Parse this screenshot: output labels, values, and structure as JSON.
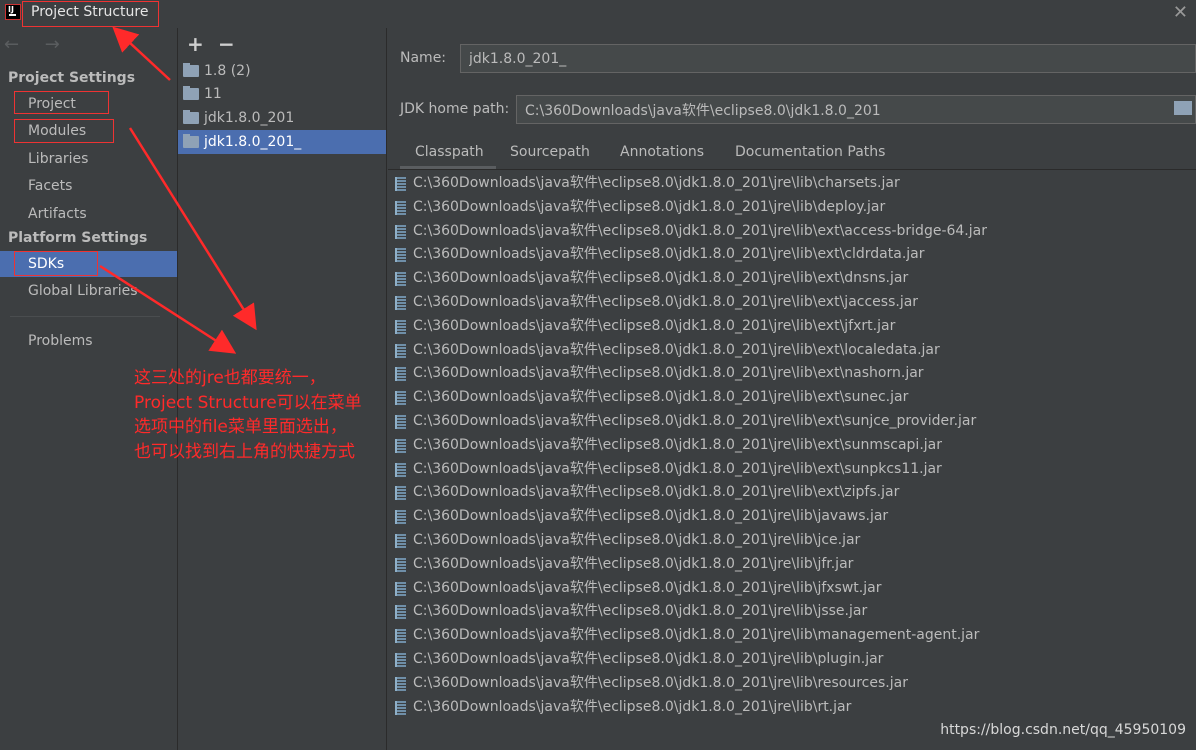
{
  "window": {
    "title": "Project Structure",
    "close_glyph": "✕"
  },
  "nav": {
    "back_forward": "← →",
    "project_settings_title": "Project Settings",
    "project_items": [
      "Project",
      "Modules",
      "Libraries",
      "Facets",
      "Artifacts"
    ],
    "platform_settings_title": "Platform Settings",
    "platform_items": [
      "SDKs",
      "Global Libraries"
    ],
    "problems": "Problems",
    "selected": "SDKs"
  },
  "sdk_panel": {
    "add_label": "+",
    "remove_label": "−",
    "items": [
      "1.8 (2)",
      "11",
      "jdk1.8.0_201",
      "jdk1.8.0_201_"
    ],
    "selected_index": 3
  },
  "detail": {
    "name_label": "Name:",
    "name_value": "jdk1.8.0_201_",
    "home_label": "JDK home path:",
    "home_value": "C:\\360Downloads\\java软件\\eclipse8.0\\jdk1.8.0_201",
    "tabs": [
      "Classpath",
      "Sourcepath",
      "Annotations",
      "Documentation Paths"
    ],
    "active_tab": "Classpath",
    "classpath": [
      "C:\\360Downloads\\java软件\\eclipse8.0\\jdk1.8.0_201\\jre\\lib\\charsets.jar",
      "C:\\360Downloads\\java软件\\eclipse8.0\\jdk1.8.0_201\\jre\\lib\\deploy.jar",
      "C:\\360Downloads\\java软件\\eclipse8.0\\jdk1.8.0_201\\jre\\lib\\ext\\access-bridge-64.jar",
      "C:\\360Downloads\\java软件\\eclipse8.0\\jdk1.8.0_201\\jre\\lib\\ext\\cldrdata.jar",
      "C:\\360Downloads\\java软件\\eclipse8.0\\jdk1.8.0_201\\jre\\lib\\ext\\dnsns.jar",
      "C:\\360Downloads\\java软件\\eclipse8.0\\jdk1.8.0_201\\jre\\lib\\ext\\jaccess.jar",
      "C:\\360Downloads\\java软件\\eclipse8.0\\jdk1.8.0_201\\jre\\lib\\ext\\jfxrt.jar",
      "C:\\360Downloads\\java软件\\eclipse8.0\\jdk1.8.0_201\\jre\\lib\\ext\\localedata.jar",
      "C:\\360Downloads\\java软件\\eclipse8.0\\jdk1.8.0_201\\jre\\lib\\ext\\nashorn.jar",
      "C:\\360Downloads\\java软件\\eclipse8.0\\jdk1.8.0_201\\jre\\lib\\ext\\sunec.jar",
      "C:\\360Downloads\\java软件\\eclipse8.0\\jdk1.8.0_201\\jre\\lib\\ext\\sunjce_provider.jar",
      "C:\\360Downloads\\java软件\\eclipse8.0\\jdk1.8.0_201\\jre\\lib\\ext\\sunmscapi.jar",
      "C:\\360Downloads\\java软件\\eclipse8.0\\jdk1.8.0_201\\jre\\lib\\ext\\sunpkcs11.jar",
      "C:\\360Downloads\\java软件\\eclipse8.0\\jdk1.8.0_201\\jre\\lib\\ext\\zipfs.jar",
      "C:\\360Downloads\\java软件\\eclipse8.0\\jdk1.8.0_201\\jre\\lib\\javaws.jar",
      "C:\\360Downloads\\java软件\\eclipse8.0\\jdk1.8.0_201\\jre\\lib\\jce.jar",
      "C:\\360Downloads\\java软件\\eclipse8.0\\jdk1.8.0_201\\jre\\lib\\jfr.jar",
      "C:\\360Downloads\\java软件\\eclipse8.0\\jdk1.8.0_201\\jre\\lib\\jfxswt.jar",
      "C:\\360Downloads\\java软件\\eclipse8.0\\jdk1.8.0_201\\jre\\lib\\jsse.jar",
      "C:\\360Downloads\\java软件\\eclipse8.0\\jdk1.8.0_201\\jre\\lib\\management-agent.jar",
      "C:\\360Downloads\\java软件\\eclipse8.0\\jdk1.8.0_201\\jre\\lib\\plugin.jar",
      "C:\\360Downloads\\java软件\\eclipse8.0\\jdk1.8.0_201\\jre\\lib\\resources.jar",
      "C:\\360Downloads\\java软件\\eclipse8.0\\jdk1.8.0_201\\jre\\lib\\rt.jar"
    ]
  },
  "annotation": {
    "lines": [
      "这三处的jre也都要统一，",
      "Project Structure可以在菜单",
      "选项中的file菜单里面选出，",
      "也可以找到右上角的快捷方式"
    ],
    "color": "#ff2a2a"
  },
  "watermark": "https://blog.csdn.net/qq_45950109",
  "colors": {
    "background": "#3c3f41",
    "selection": "#4b6eaf",
    "text": "#bbbbbb",
    "annotation": "#ff2a2a"
  }
}
